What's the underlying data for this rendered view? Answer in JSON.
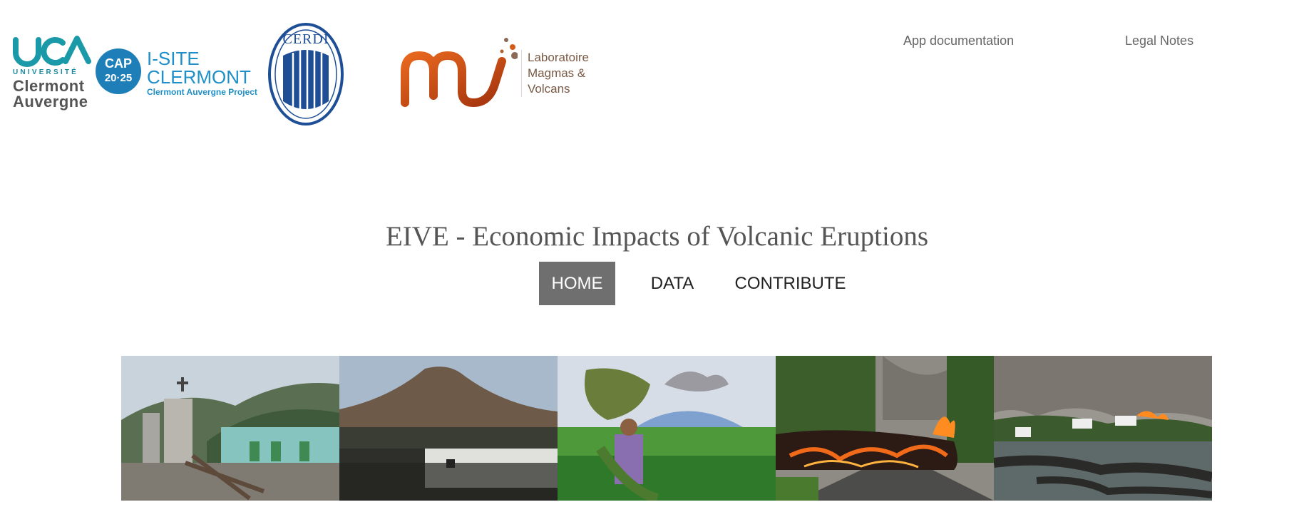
{
  "header": {
    "logos": {
      "uca": {
        "line1": "UNIVERSITÉ",
        "line2": "Clermont",
        "line3": "Auvergne"
      },
      "cap": {
        "circle_top": "CAP",
        "circle_bottom": "20·25",
        "line1": "I-SITE",
        "line2": "CLERMONT",
        "line3": "Clermont Auvergne Project"
      },
      "cerdi": {
        "name": "CERDI"
      },
      "lmv": {
        "words": [
          "Laboratoire",
          "Magmas &",
          "Volcans"
        ]
      }
    },
    "links": {
      "documentation": "App documentation",
      "legal": "Legal Notes"
    }
  },
  "title": "EIVE - Economic Impacts of Volcanic Eruptions",
  "nav": {
    "home": "HOME",
    "data": "DATA",
    "contribute": "CONTRIBUTE",
    "active": "HOME"
  },
  "colors": {
    "nav_active_bg": "#6f6f6f",
    "link_gray": "#666666",
    "lmv_orange": "#d35a17",
    "cap_blue": "#1e7fb8"
  }
}
